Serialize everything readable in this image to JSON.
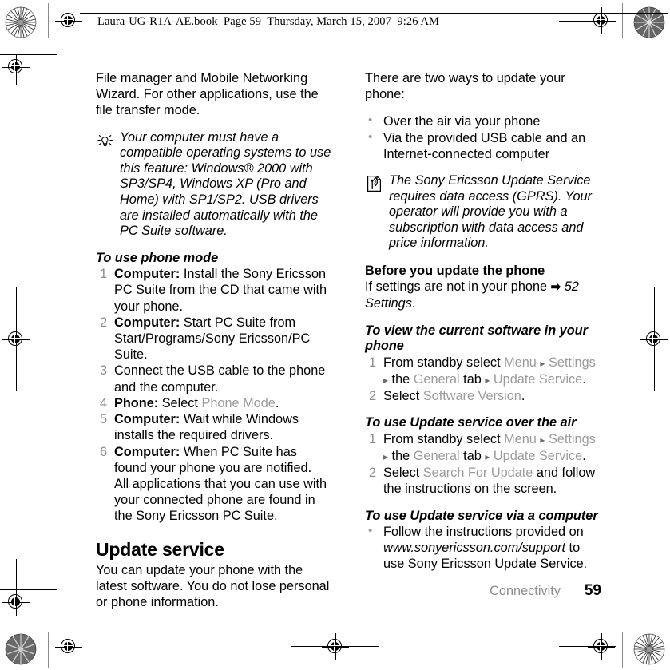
{
  "header": {
    "text": "Laura-UG-R1A-AE.book  Page 59  Thursday, March 15, 2007  9:26 AM"
  },
  "left_column": {
    "intro_paragraph": "File manager and Mobile Networking Wizard. For other applications, use the file transfer mode.",
    "tip_icon": "lightbulb-tip-icon",
    "tip_note": "Your computer must have a compatible operating systems to use this feature: Windows® 2000 with SP3/SP4, Windows XP (Pro and Home) with SP1/SP2. USB drivers are installed automatically with the PC Suite software.",
    "procedure_heading": "To use phone mode",
    "steps": [
      {
        "num": "1",
        "lead": "Computer:",
        "text": " Install the Sony Ericsson PC Suite from the CD that came with your phone."
      },
      {
        "num": "2",
        "lead": "Computer:",
        "text": " Start PC Suite from Start/Programs/Sony Ericsson/PC Suite."
      },
      {
        "num": "3",
        "lead": "",
        "text": "Connect the USB cable to the phone and the computer."
      },
      {
        "num": "4",
        "lead": "Phone:",
        "text": " Select ",
        "menu_term": "Phone Mode",
        "text_after": "."
      },
      {
        "num": "5",
        "lead": "Computer:",
        "text": " Wait while Windows installs the required drivers."
      },
      {
        "num": "6",
        "lead": "Computer:",
        "text": " When PC Suite has found your phone you are notified.",
        "continuation": "All applications that you can use with your connected phone are found in the Sony Ericsson PC Suite."
      }
    ],
    "section_heading": "Update service",
    "section_paragraph": "You can update your phone with the latest software. You do not lose personal or phone information."
  },
  "right_column": {
    "intro_paragraph": "There are two ways to update your phone:",
    "bullets": [
      "Over the air via your phone",
      "Via the provided USB cable and an Internet-connected computer"
    ],
    "note_icon": "page-signal-note-icon",
    "note_text": "The Sony Ericsson Update Service requires data access (GPRS). Your operator will provide you with a subscription with data access and price information.",
    "before_heading": "Before you update the phone",
    "before_text_1": "If settings are not in your phone ",
    "before_arrow": "➡",
    "before_xref": "52 Settings",
    "before_text_2": ".",
    "proc1_heading": "To view the current software in your phone",
    "proc1_steps": [
      {
        "num": "1",
        "prefix": "From standby select ",
        "menu": [
          "Menu",
          "Settings"
        ],
        "mid": " the ",
        "menu2": "General",
        "mid2": " tab ",
        "menu3": "Update Service",
        "suffix": "."
      },
      {
        "num": "2",
        "prefix": "Select ",
        "menu_only": "Software Version",
        "suffix": "."
      }
    ],
    "proc2_heading": "To use Update service over the air",
    "proc2_steps": [
      {
        "num": "1",
        "prefix": "From standby select ",
        "menu": [
          "Menu",
          "Settings"
        ],
        "mid": " the ",
        "menu2": "General",
        "mid2": " tab ",
        "menu3": "Update Service",
        "suffix": "."
      },
      {
        "num": "2",
        "prefix": "Select ",
        "menu_only": "Search For Update",
        "suffix": " and follow the instructions on the screen."
      }
    ],
    "proc3_heading": "To use Update service via a computer",
    "proc3_bullet_prefix": "Follow the instructions provided on ",
    "proc3_bullet_url": "www.sonyericsson.com/support",
    "proc3_bullet_suffix": " to use Sony Ericsson Update Service."
  },
  "footer": {
    "chapter": "Connectivity",
    "page_number": "59"
  },
  "separator_symbol": "▸",
  "colors": {
    "menu_term_gray": "#9b9b9b",
    "step_number_gray": "#8d8d8d",
    "body_black": "#000000",
    "page_background": "#ffffff"
  }
}
